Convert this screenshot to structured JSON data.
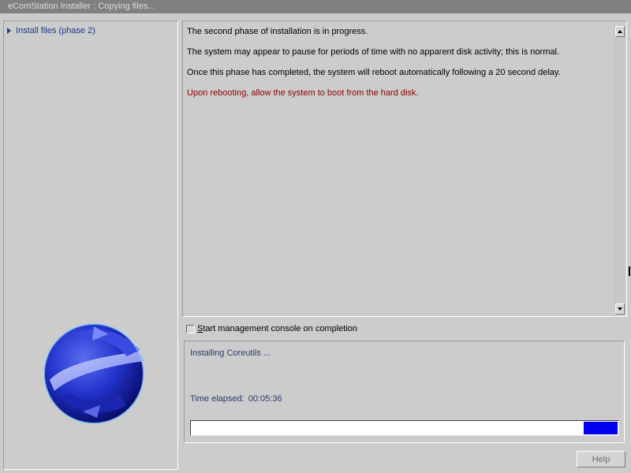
{
  "window": {
    "title": "eComStation Installer : Copying files..."
  },
  "sidebar": {
    "items": [
      {
        "label": "Install files (phase 2)",
        "icon": "triangle-right-icon"
      }
    ],
    "logo": "ecomstation-globe-logo"
  },
  "message": {
    "lines": [
      "The second phase of installation is in progress.",
      "The system may appear to pause for periods of time with no apparent disk activity; this is normal.",
      "Once this phase has completed, the system will reboot automatically following a 20 second delay."
    ],
    "warning": "Upon rebooting, allow the system to boot from the hard disk."
  },
  "options": {
    "console_checkbox": {
      "label_first": "S",
      "label_rest": "tart management console on completion",
      "checked": false
    }
  },
  "status": {
    "current": "Installing Coreutils ...",
    "elapsed_label": "Time elapsed:",
    "elapsed_value": "00:05:36",
    "progress_segment": [
      0.918,
      0.998
    ]
  },
  "footer": {
    "help_label": "Help"
  },
  "colors": {
    "background": "#cccccc",
    "titlebar": "#808080",
    "link_text": "#1a3a8a",
    "warning_text": "#8b0000",
    "progress_fill": "#0000ee"
  }
}
